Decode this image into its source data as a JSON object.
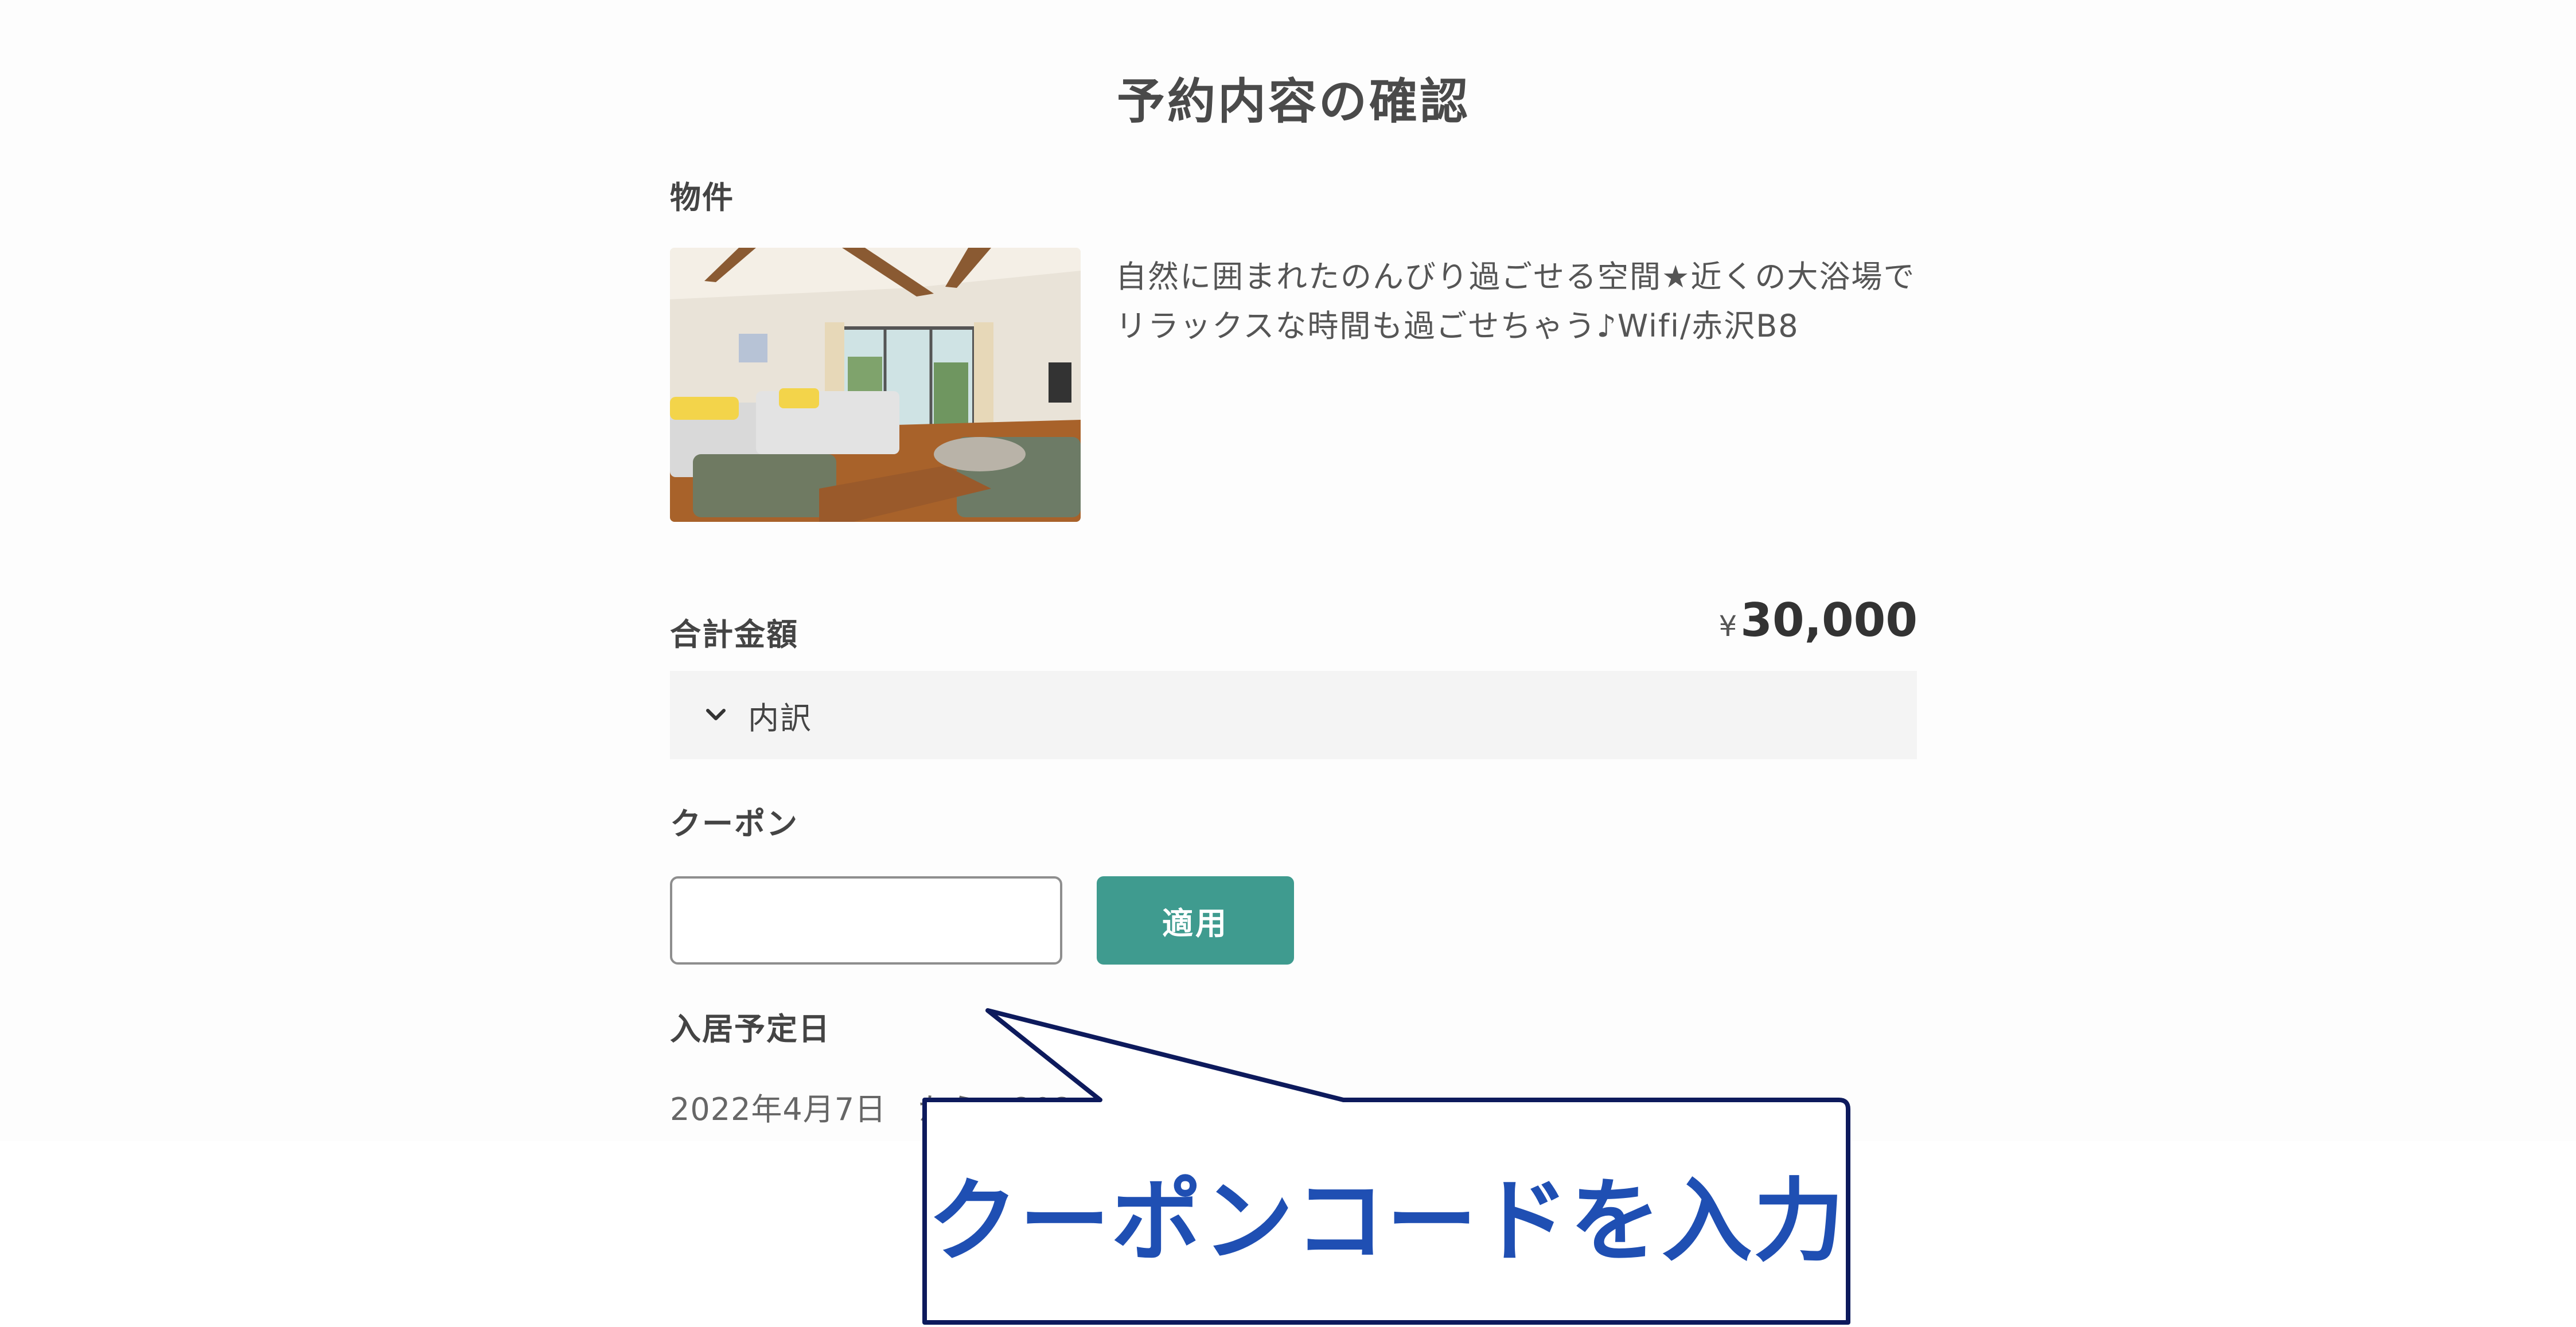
{
  "page": {
    "title": "予約内容の確認"
  },
  "property": {
    "section_label": "物件",
    "image_name": "room-photo",
    "description": "自然に囲まれたのんびり過ごせる空間★近くの大浴場でリラックスな時間も過ごせちゃう♪Wifi/赤沢B8"
  },
  "total": {
    "label": "合計金額",
    "currency_symbol": "¥",
    "amount": "30,000"
  },
  "breakdown": {
    "label": "内訳",
    "icon": "chevron-down-icon"
  },
  "coupon": {
    "label": "クーポン",
    "input_value": "",
    "input_placeholder": "",
    "apply_label": "適用"
  },
  "checkin": {
    "label": "入居予定日",
    "date_text": "2022年4月7日　から　202"
  },
  "callout": {
    "text": "クーポンコードを入力"
  },
  "colors": {
    "accent": "#3f9b8f",
    "callout_text": "#1f4fb3",
    "callout_border": "#0d1a5c"
  }
}
